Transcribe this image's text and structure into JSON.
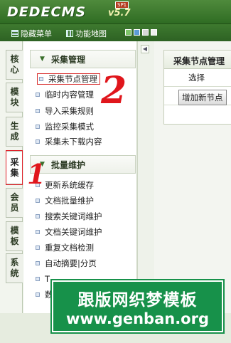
{
  "header": {
    "logo": "DEDECMS",
    "version": "v5.7",
    "edition": "SP1"
  },
  "toolbar": {
    "hide_menu": "隐藏菜单",
    "function_map": "功能地图",
    "swatch_colors": [
      "#7ec46a",
      "#5b9bd5",
      "#d7d7d7",
      "#efefef"
    ]
  },
  "left_tabs": [
    {
      "label": "核\n心"
    },
    {
      "label": "模\n块"
    },
    {
      "label": "生\n成"
    },
    {
      "label": "采\n集"
    },
    {
      "label": "会\n员"
    },
    {
      "label": "模\n板"
    },
    {
      "label": "系\n统"
    }
  ],
  "menu": {
    "section1": {
      "title": "采集管理",
      "items": [
        "采集节点管理",
        "临时内容管理",
        "导入采集规则",
        "监控采集模式",
        "采集未下载内容"
      ]
    },
    "section2": {
      "title": "批量维护",
      "items": [
        "更新系统缓存",
        "文档批量维护",
        "搜索关键词维护",
        "文档关键词维护",
        "重复文档检测",
        "自动摘要|分页",
        "T",
        "数"
      ]
    }
  },
  "content": {
    "title": "采集节点管理",
    "select_label": "选择",
    "add_button": "增加新节点"
  },
  "annotations": {
    "one": "1",
    "two": "2"
  },
  "watermark": {
    "line1": "跟版网织梦模板",
    "line2": "www.genban.org"
  }
}
